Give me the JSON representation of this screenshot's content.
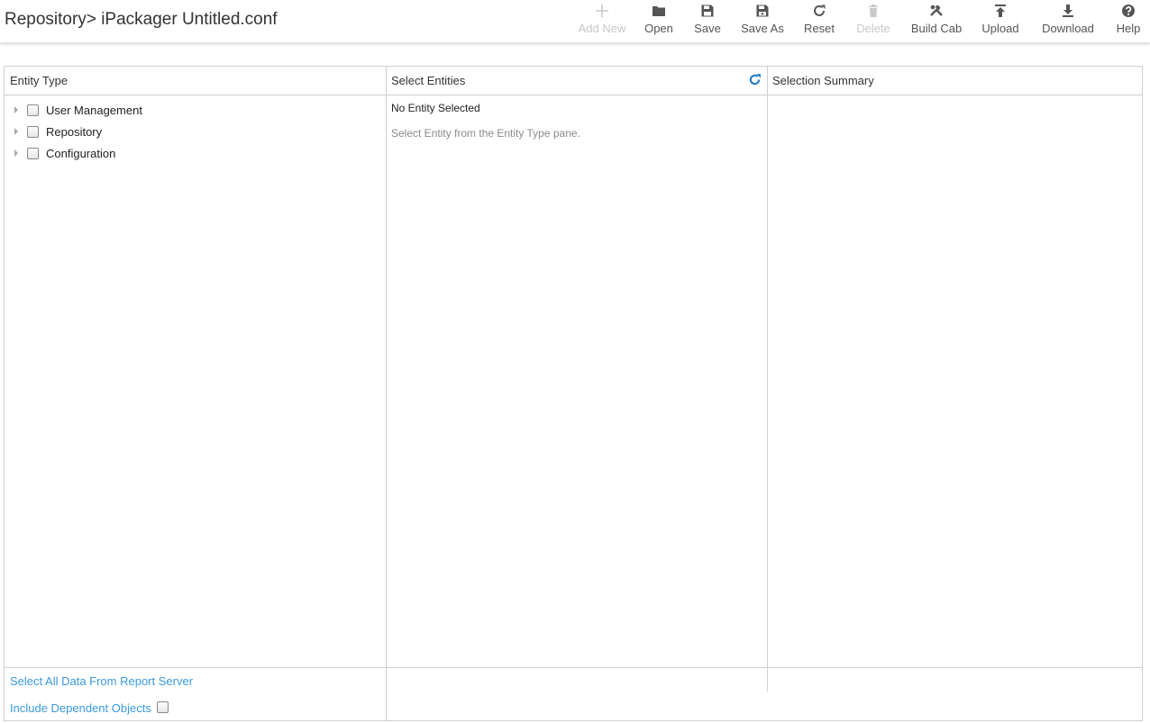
{
  "header": {
    "title": "Repository> iPackager Untitled.conf"
  },
  "toolbar": {
    "add_new": "Add New",
    "open": "Open",
    "save": "Save",
    "save_as": "Save As",
    "reset": "Reset",
    "delete": "Delete",
    "build_cab": "Build Cab",
    "upload": "Upload",
    "download": "Download",
    "help": "Help"
  },
  "columns": {
    "entity_type": "Entity Type",
    "select_entities": "Select Entities",
    "selection_summary": "Selection Summary"
  },
  "tree": {
    "items": [
      {
        "label": "User Management",
        "checked": false
      },
      {
        "label": "Repository",
        "checked": false
      },
      {
        "label": "Configuration",
        "checked": false
      }
    ]
  },
  "select_entities": {
    "status": "No Entity Selected",
    "hint": "Select Entity from the Entity Type pane."
  },
  "footer": {
    "select_all": "Select All Data From Report Server",
    "include_dependent": "Include Dependent Objects",
    "include_dependent_checked": false
  },
  "colors": {
    "link": "#3a9ad9",
    "refresh": "#1f7ac4",
    "disabled": "#c8c8c8",
    "border": "#cfcfcf"
  },
  "icons": {
    "add_new": "plus-icon",
    "open": "folder-icon",
    "save": "floppy-icon",
    "save_as": "floppy-plus-icon",
    "reset": "refresh-icon",
    "delete": "trash-icon",
    "build_cab": "hammer-wrench-icon",
    "upload": "upload-icon",
    "download": "download-icon",
    "help": "question-circle-icon",
    "refresh_entities": "refresh-icon",
    "expand": "caret-right-icon"
  }
}
